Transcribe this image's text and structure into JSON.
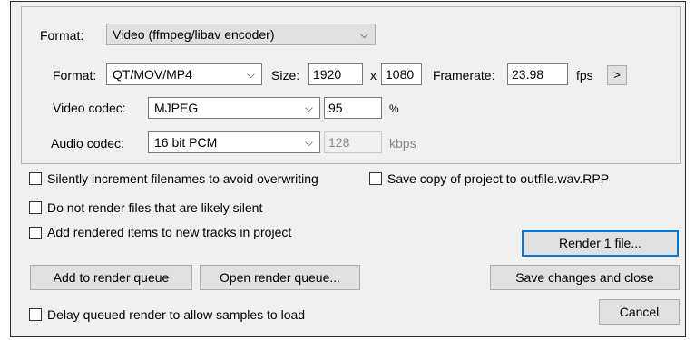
{
  "video_panel": {
    "format_label": "Format:",
    "format_value": "Video (ffmpeg/libav encoder)",
    "container_label": "Format:",
    "container_value": "QT/MOV/MP4",
    "size_label": "Size:",
    "width": "1920",
    "x_sep": "x",
    "height": "1080",
    "framerate_label": "Framerate:",
    "framerate": "23.98",
    "fps_unit": "fps",
    "more_button": ">",
    "video_codec_label": "Video codec:",
    "video_codec": "MJPEG",
    "quality": "95",
    "quality_unit": "%",
    "audio_codec_label": "Audio codec:",
    "audio_codec": "16 bit PCM",
    "audio_bitrate": "128",
    "audio_bitrate_unit": "kbps"
  },
  "options": {
    "increment_filenames": {
      "label": "Silently increment filenames to avoid overwriting",
      "checked": false
    },
    "save_project_copy": {
      "label": "Save copy of project to outfile.wav.RPP",
      "checked": false
    },
    "skip_silent": {
      "label": "Do not render files that are likely silent",
      "checked": false
    },
    "add_to_tracks": {
      "label": "Add rendered items to new tracks in project",
      "checked": false
    },
    "delay_queued": {
      "label": "Delay queued render to allow samples to load",
      "checked": false
    }
  },
  "buttons": {
    "render": "Render 1 file...",
    "add_to_queue": "Add to render queue",
    "open_queue": "Open render queue...",
    "save_close": "Save changes and close",
    "cancel": "Cancel"
  }
}
